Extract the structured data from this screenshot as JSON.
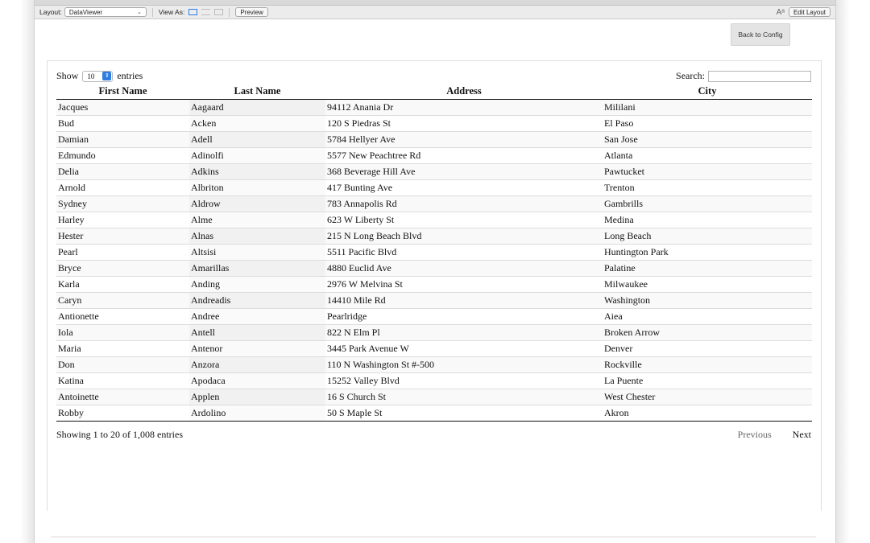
{
  "toolbar": {
    "layout_label": "Layout:",
    "layout_value": "DataViewer",
    "view_as_label": "View As:",
    "preview_label": "Preview",
    "font_icon": "Aᵃ",
    "edit_layout_label": "Edit Layout"
  },
  "back_button": "Back to Config",
  "table_controls": {
    "show_label": "Show",
    "entries_value": "10",
    "entries_label": "entries",
    "search_label": "Search:"
  },
  "columns": [
    "First Name",
    "Last Name",
    "Address",
    "City"
  ],
  "rows": [
    [
      "Jacques",
      "Aagaard",
      "94112 Anania Dr",
      "Mililani"
    ],
    [
      "Bud",
      "Acken",
      "120 S Piedras St",
      "El Paso"
    ],
    [
      "Damian",
      "Adell",
      "5784 Hellyer Ave",
      "San Jose"
    ],
    [
      "Edmundo",
      "Adinolfi",
      "5577 New Peachtree Rd",
      "Atlanta"
    ],
    [
      "Delia",
      "Adkins",
      "368 Beverage Hill Ave",
      "Pawtucket"
    ],
    [
      "Arnold",
      "Albriton",
      "417 Bunting Ave",
      "Trenton"
    ],
    [
      "Sydney",
      "Aldrow",
      "783 Annapolis Rd",
      "Gambrills"
    ],
    [
      "Harley",
      "Alme",
      "623 W Liberty St",
      "Medina"
    ],
    [
      "Hester",
      "Alnas",
      "215 N Long Beach Blvd",
      "Long Beach"
    ],
    [
      "Pearl",
      "Altsisi",
      "5511 Pacific Blvd",
      "Huntington Park"
    ],
    [
      "Bryce",
      "Amarillas",
      "4880 Euclid Ave",
      "Palatine"
    ],
    [
      "Karla",
      "Anding",
      "2976 W Melvina St",
      "Milwaukee"
    ],
    [
      "Caryn",
      "Andreadis",
      "14410 Mile Rd",
      "Washington"
    ],
    [
      "Antionette",
      "Andree",
      "Pearlridge",
      "Aiea"
    ],
    [
      "Iola",
      "Antell",
      "822 N Elm Pl",
      "Broken Arrow"
    ],
    [
      "Maria",
      "Antenor",
      "3445 Park Avenue W",
      "Denver"
    ],
    [
      "Don",
      "Anzora",
      "110 N Washington St #-500",
      "Rockville"
    ],
    [
      "Katina",
      "Apodaca",
      "15252 Valley Blvd",
      "La Puente"
    ],
    [
      "Antoinette",
      "Applen",
      "16 S Church St",
      "West Chester"
    ],
    [
      "Robby",
      "Ardolino",
      "50 S Maple St",
      "Akron"
    ]
  ],
  "info_text": "Showing 1 to 20 of 1,008 entries",
  "pagination": {
    "previous": "Previous",
    "next": "Next"
  },
  "icons": {
    "layout_dropdown": "chevron-down-icon",
    "view_form": "form-view-icon",
    "view_list": "list-view-icon",
    "view_table": "table-view-icon",
    "font_size": "font-size-icon",
    "entries_dropdown": "stepper-icon"
  },
  "colors": {
    "accent": "#2f7de1",
    "button_bg": "#e4e4e4"
  }
}
